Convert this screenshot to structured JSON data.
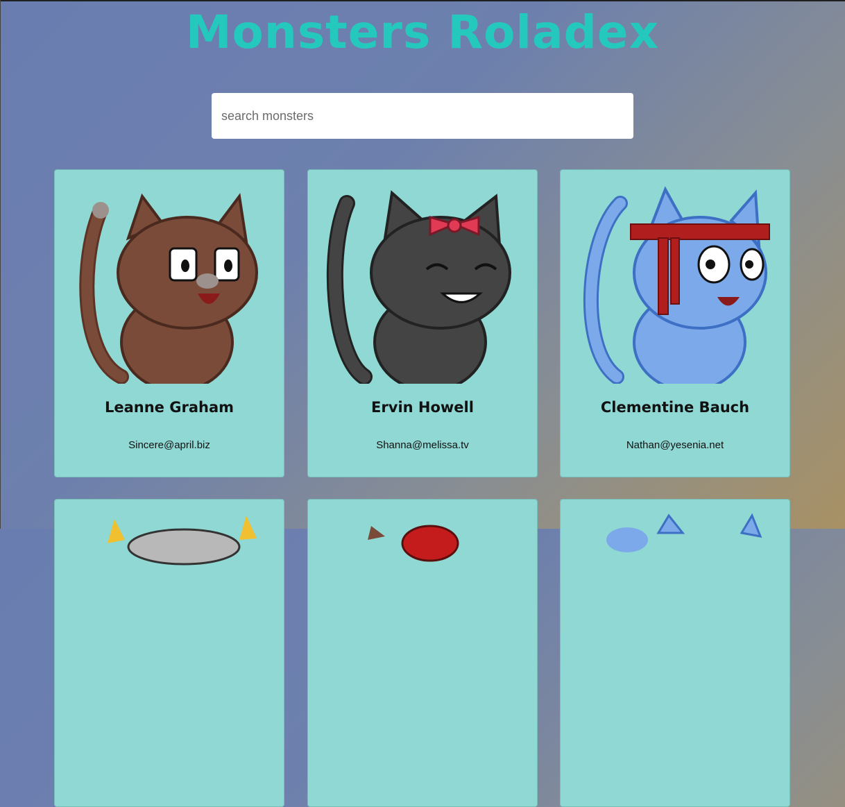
{
  "app": {
    "title": "Monsters Roladex"
  },
  "search": {
    "placeholder": "search monsters",
    "value": ""
  },
  "monsters": [
    {
      "name": "Leanne Graham",
      "email": "Sincere@april.biz",
      "image": "brown-cat-icon",
      "body_color": "#7b4b3a"
    },
    {
      "name": "Ervin Howell",
      "email": "Shanna@melissa.tv",
      "image": "black-cat-with-bow-icon",
      "body_color": "#444444"
    },
    {
      "name": "Clementine Bauch",
      "email": "Nathan@yesenia.net",
      "image": "blue-cat-with-headband-icon",
      "body_color": "#7ba9ea"
    }
  ],
  "colors": {
    "title": "#25c8bd",
    "card": "#8fd8d3"
  }
}
